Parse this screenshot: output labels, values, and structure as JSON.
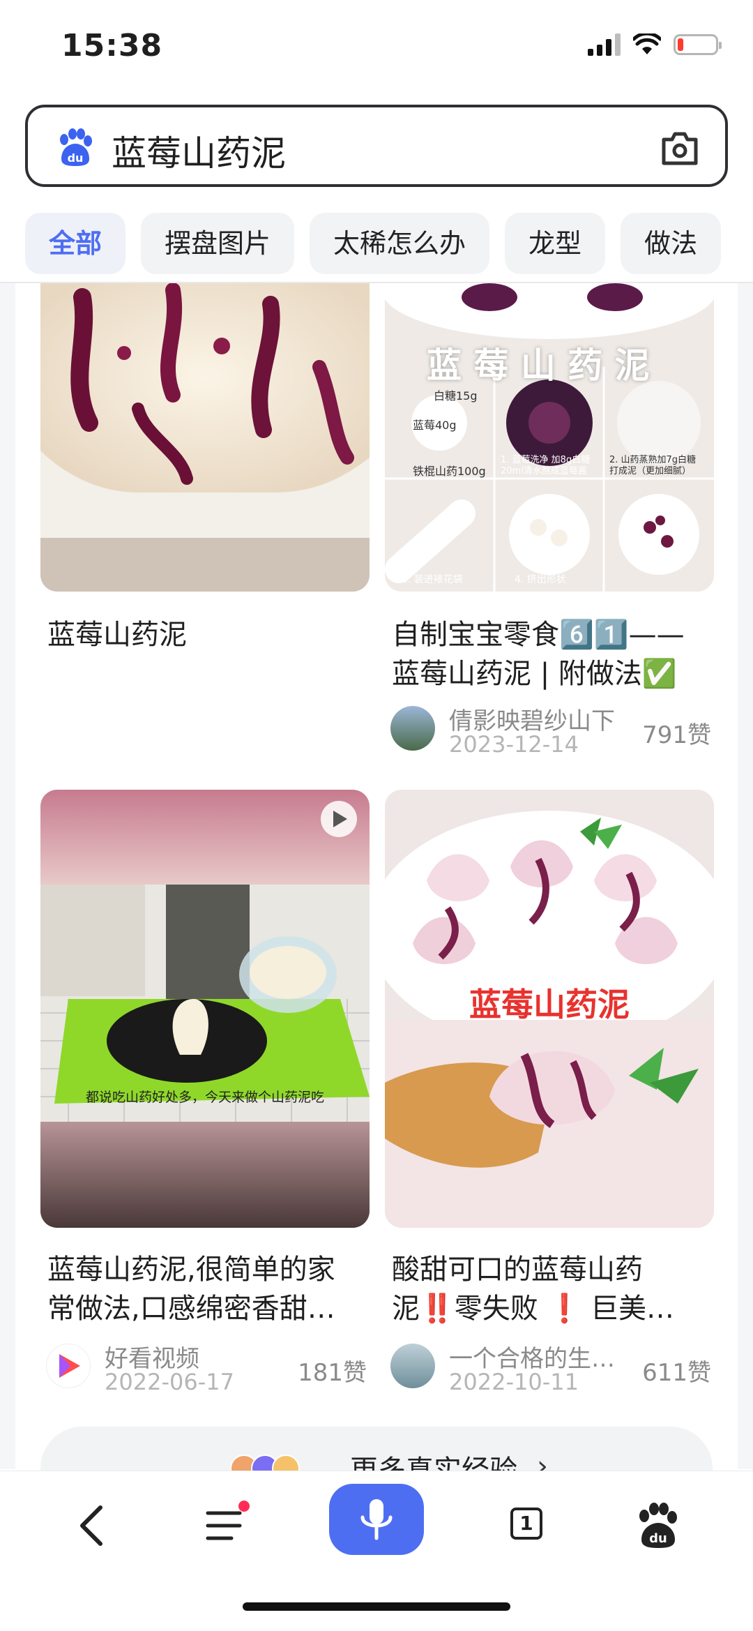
{
  "status_bar": {
    "time": "15:38",
    "battery_color": "#ff3b30"
  },
  "search": {
    "query": "蓝莓山药泥",
    "logo_icon": "baidu-paw-icon",
    "camera_icon": "camera-icon"
  },
  "tabs": [
    {
      "label": "全部",
      "active": true
    },
    {
      "label": "摆盘图片"
    },
    {
      "label": "太稀怎么办"
    },
    {
      "label": "龙型"
    },
    {
      "label": "做法"
    }
  ],
  "cards": [
    {
      "title": "蓝莓山药泥"
    },
    {
      "title_line1": "自制宝宝零食6️⃣1️⃣——",
      "title_line2": "蓝莓山药泥 | 附做法✅",
      "image_caption": "蓝 莓 山 药 泥",
      "steps": [
        "1. 蓝莓洗净 加8g白糖 20ml清水熬成蓝莓酱",
        "2. 山药蒸熟加7g白糖 打成泥（更加细腻）",
        "3. 装进裱花袋",
        "4. 挤出形状"
      ],
      "ingredients": [
        "白糖15g",
        "蓝莓40g",
        "铁棍山药100g"
      ],
      "author": "倩影映碧纱山下",
      "date": "2023-12-14",
      "likes": "791赞"
    },
    {
      "title_line1": "蓝莓山药泥,很简单的家",
      "title_line2": "常做法,口感绵密香甜…",
      "video_subtitle": "都说吃山药好处多，今天来做个山药泥吃",
      "author": "好看视频",
      "date": "2022-06-17",
      "likes": "181赞"
    },
    {
      "title_line1": "酸甜可口的蓝莓山药",
      "title_line2": "泥‼️零失败 ❗ 巨美…",
      "image_caption": "蓝莓山药泥",
      "author": "一个合格的生…",
      "date": "2022-10-11",
      "likes": "611赞"
    }
  ],
  "more_button": {
    "label": "更多真实经验",
    "arrow": "›"
  },
  "bottom_bar": {
    "back_icon": "back-chevron-icon",
    "menu_icon": "menu-icon",
    "mic_icon": "microphone-icon",
    "tabs_count": "1",
    "paw_icon": "baidu-paw-icon",
    "accent": "#4e6ef2"
  }
}
